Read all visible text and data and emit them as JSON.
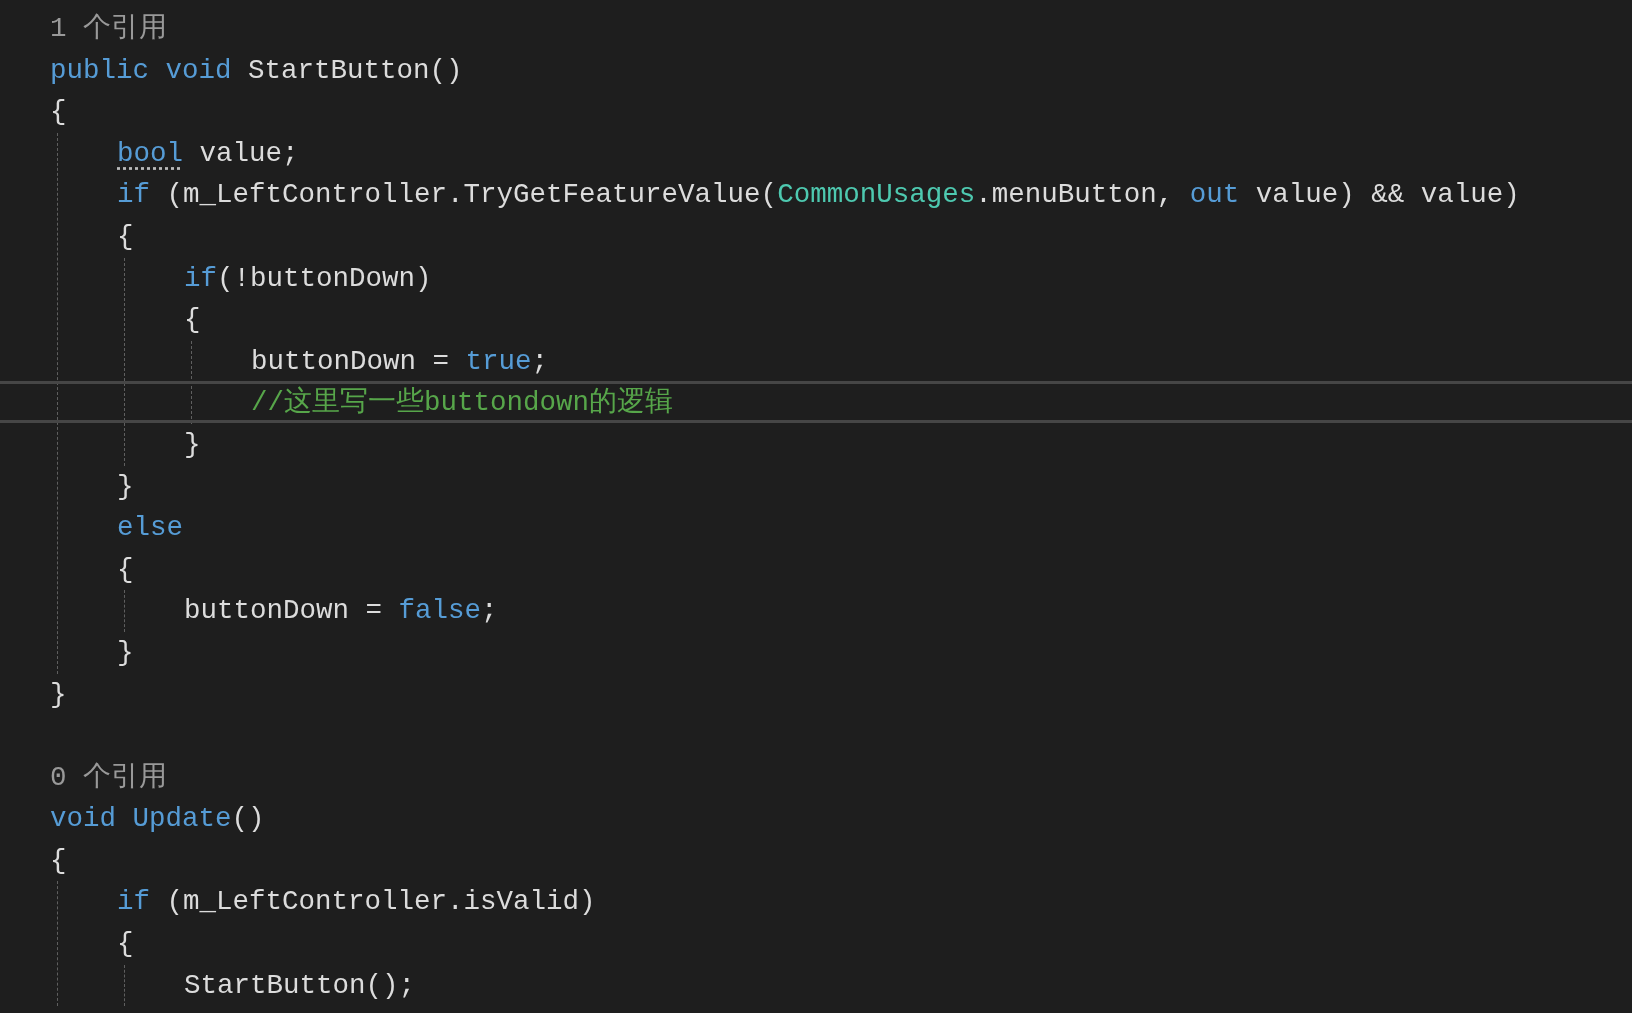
{
  "lines": [
    {
      "kind": "codelens",
      "text": "1 个引用"
    },
    {
      "kind": "code",
      "tokens": [
        {
          "kind": "keyword",
          "text": "public void"
        },
        {
          "kind": "plain",
          "text": " StartButton()"
        }
      ]
    },
    {
      "kind": "code",
      "tokens": [
        {
          "kind": "plain",
          "text": "{"
        }
      ]
    },
    {
      "kind": "block",
      "children": [
        {
          "kind": "code",
          "tokens": [
            {
              "kind": "keyword",
              "text": "bool",
              "suggestion": true
            },
            {
              "kind": "plain",
              "text": " value;"
            }
          ]
        },
        {
          "kind": "code",
          "tokens": [
            {
              "kind": "keyword",
              "text": "if"
            },
            {
              "kind": "plain",
              "text": " (m_LeftController.TryGetFeatureValue("
            },
            {
              "kind": "type",
              "text": "CommonUsages"
            },
            {
              "kind": "plain",
              "text": ".menuButton, "
            },
            {
              "kind": "keyword",
              "text": "out"
            },
            {
              "kind": "plain",
              "text": " value) && value)"
            }
          ]
        },
        {
          "kind": "code",
          "tokens": [
            {
              "kind": "plain",
              "text": "{"
            }
          ]
        },
        {
          "kind": "block",
          "children": [
            {
              "kind": "code",
              "tokens": [
                {
                  "kind": "keyword",
                  "text": "if"
                },
                {
                  "kind": "plain",
                  "text": "(!buttonDown)"
                }
              ]
            },
            {
              "kind": "code",
              "tokens": [
                {
                  "kind": "plain",
                  "text": "{"
                }
              ]
            },
            {
              "kind": "block",
              "children": [
                {
                  "kind": "code",
                  "current": false,
                  "tokens": [
                    {
                      "kind": "plain",
                      "text": "buttonDown = "
                    },
                    {
                      "kind": "keyword",
                      "text": "true"
                    },
                    {
                      "kind": "plain",
                      "text": ";"
                    }
                  ]
                },
                {
                  "kind": "code",
                  "current": true,
                  "tokens": [
                    {
                      "kind": "comment",
                      "text": "//这里写一些buttondown的逻辑"
                    }
                  ]
                }
              ]
            },
            {
              "kind": "code",
              "tokens": [
                {
                  "kind": "plain",
                  "text": "}"
                }
              ]
            }
          ]
        },
        {
          "kind": "code",
          "tokens": [
            {
              "kind": "plain",
              "text": "}"
            }
          ]
        },
        {
          "kind": "code",
          "tokens": [
            {
              "kind": "keyword",
              "text": "else"
            }
          ]
        },
        {
          "kind": "code",
          "tokens": [
            {
              "kind": "plain",
              "text": "{"
            }
          ]
        },
        {
          "kind": "block",
          "children": [
            {
              "kind": "code",
              "tokens": [
                {
                  "kind": "plain",
                  "text": "buttonDown = "
                },
                {
                  "kind": "keyword",
                  "text": "false"
                },
                {
                  "kind": "plain",
                  "text": ";"
                }
              ]
            }
          ]
        },
        {
          "kind": "code",
          "tokens": [
            {
              "kind": "plain",
              "text": "}"
            }
          ]
        }
      ]
    },
    {
      "kind": "code",
      "tokens": [
        {
          "kind": "plain",
          "text": "}"
        }
      ]
    },
    {
      "kind": "blank"
    },
    {
      "kind": "codelens",
      "text": "0 个引用"
    },
    {
      "kind": "code",
      "tokens": [
        {
          "kind": "keyword",
          "text": "void Update"
        },
        {
          "kind": "plain",
          "text": "()"
        }
      ]
    },
    {
      "kind": "code",
      "tokens": [
        {
          "kind": "plain",
          "text": "{"
        }
      ]
    },
    {
      "kind": "block",
      "children": [
        {
          "kind": "code",
          "tokens": [
            {
              "kind": "keyword",
              "text": "if"
            },
            {
              "kind": "plain",
              "text": " (m_LeftController.isValid)"
            }
          ]
        },
        {
          "kind": "code",
          "tokens": [
            {
              "kind": "plain",
              "text": "{"
            }
          ]
        },
        {
          "kind": "block",
          "children": [
            {
              "kind": "code",
              "tokens": [
                {
                  "kind": "plain",
                  "text": "StartButton();"
                }
              ]
            }
          ]
        }
      ]
    }
  ]
}
